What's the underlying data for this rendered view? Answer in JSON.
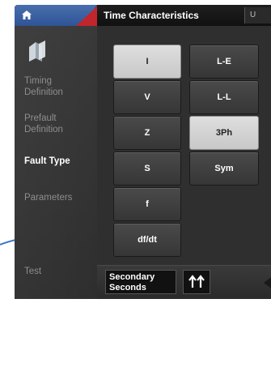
{
  "header": {
    "title": "Time Characteristics",
    "right_label": "U"
  },
  "sidebar": {
    "items": [
      {
        "label": "Timing\nDefinition",
        "active": false
      },
      {
        "label": "Prefault\nDefinition",
        "active": false
      },
      {
        "label": "Fault Type",
        "active": true
      },
      {
        "label": "Parameters",
        "active": false
      },
      {
        "label": "Test",
        "active": false
      }
    ]
  },
  "left_buttons": [
    {
      "label": "I",
      "selected": true
    },
    {
      "label": "V",
      "selected": false
    },
    {
      "label": "Z",
      "selected": false
    },
    {
      "label": "S",
      "selected": false
    },
    {
      "label": "f",
      "selected": false
    },
    {
      "label": "df/dt",
      "selected": false
    }
  ],
  "right_buttons": [
    {
      "label": "L-E",
      "selected": false
    },
    {
      "label": "L-L",
      "selected": false
    },
    {
      "label": "3Ph",
      "selected": true
    },
    {
      "label": "Sym",
      "selected": false
    }
  ],
  "bottom": {
    "mode_label": "Secondary\nSeconds"
  },
  "colors": {
    "home_tab": "#2f5597",
    "accent_red": "#c0262c",
    "selected_button": "#d4d4d4",
    "panel": "#2f2f2f"
  },
  "icons": [
    "home-icon",
    "app-logo-icon",
    "swap-arrows-icon"
  ]
}
